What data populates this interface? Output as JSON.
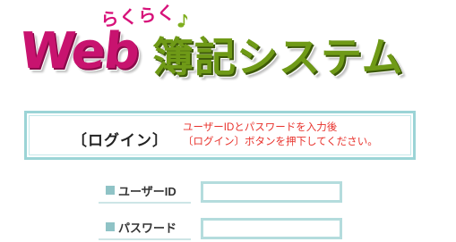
{
  "logo": {
    "script_text": "らくらく",
    "web_text": "Web",
    "title_text": "簿記システム",
    "colors": {
      "magenta": "#c8136f",
      "green": "#6f9a17"
    }
  },
  "login_banner": {
    "heading": "〔ログイン〕",
    "message_line1": "ユーザーIDとパスワードを入力後",
    "message_line2": "〔ログイン〕ボタンを押下してください。",
    "message_color": "#e8322c",
    "border_color": "#9bd4d6"
  },
  "form": {
    "user_id": {
      "label": "ユーザーID",
      "value": "",
      "placeholder": ""
    },
    "password": {
      "label": "パスワード",
      "value": "",
      "placeholder": ""
    }
  }
}
